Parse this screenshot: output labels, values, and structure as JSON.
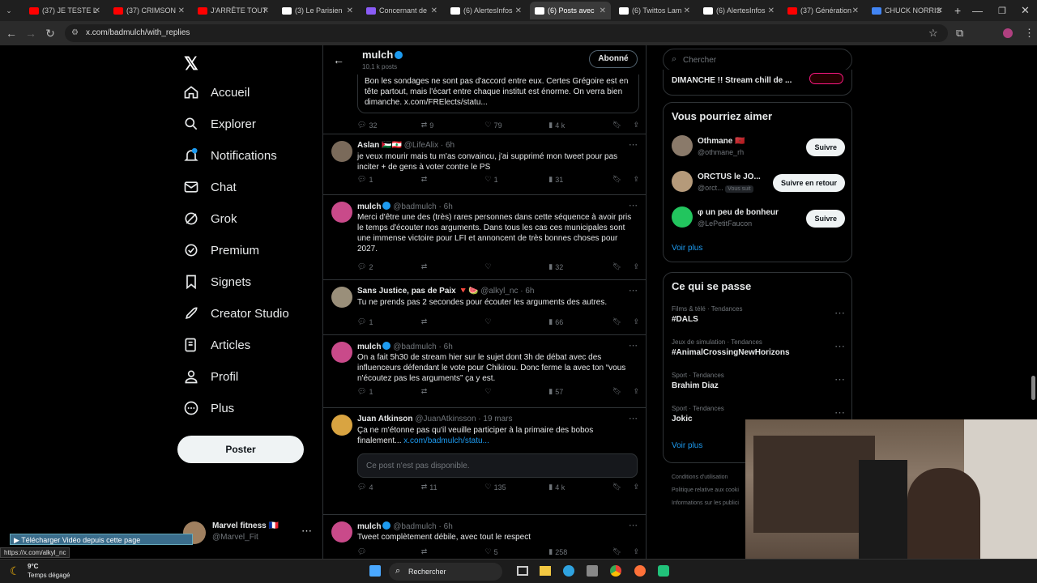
{
  "tabs": [
    {
      "label": "(37) JE TESTE L",
      "color": "#ff0000"
    },
    {
      "label": "(37) CRIMSON",
      "color": "#ff0000"
    },
    {
      "label": "J'ARRÊTE TOUT",
      "color": "#ff0000"
    },
    {
      "label": "(3) Le Parisien",
      "color": "#ffffff"
    },
    {
      "label": "Concernant de",
      "color": "#8a5cf6"
    },
    {
      "label": "(6) AlertesInfos",
      "color": "#ffffff"
    },
    {
      "label": "(6) Posts avec",
      "color": "#ffffff"
    },
    {
      "label": "(6) Twittos Lam",
      "color": "#ffffff"
    },
    {
      "label": "(6) AlertesInfos",
      "color": "#ffffff"
    },
    {
      "label": "(37) Génération",
      "color": "#ff0000"
    },
    {
      "label": "CHUCK NORRIS",
      "color": "#4285f4"
    }
  ],
  "url": "x.com/badmulch/with_replies",
  "nav": {
    "home": "Accueil",
    "explore": "Explorer",
    "notifications": "Notifications",
    "chat": "Chat",
    "grok": "Grok",
    "premium": "Premium",
    "bookmarks": "Signets",
    "creator": "Creator Studio",
    "articles": "Articles",
    "profile": "Profil",
    "more": "Plus",
    "post_button": "Poster"
  },
  "account": {
    "name": "Marvel fitness 🇫🇷",
    "handle": "@Marvel_Fit"
  },
  "header": {
    "name": "mulch",
    "posts": "10,1 k posts",
    "subscribed": "Abonné"
  },
  "tweets": [
    {
      "quote_text": "Bon les sondages ne sont pas d'accord entre eux. Certes Grégoire est en tête partout, mais l'écart entre chaque institut est énorme. On verra bien dimanche. x.com/FRElects/statu...",
      "replies": "32",
      "retweets": "9",
      "likes": "79",
      "views": "4 k"
    },
    {
      "name": "Aslan 🇵🇸🇱🇧",
      "handle": "@LifeAlix · 6h",
      "text": "je veux mourir mais tu m'as convaincu, j'ai supprimé mon tweet pour pas inciter + de gens à voter contre le PS",
      "replies": "1",
      "retweets": "",
      "likes": "1",
      "views": "31",
      "avatar": "#7a6a5a"
    },
    {
      "name": "mulch",
      "handle": "@badmulch · 6h",
      "text": "Merci d'être une des (très) rares personnes dans cette séquence à avoir pris le temps d'écouter nos arguments. Dans tous les cas ces municipales sont une immense victoire pour LFI et annoncent de très bonnes choses pour 2027.",
      "replies": "2",
      "retweets": "",
      "likes": "",
      "views": "32",
      "avatar": "#c94a8a"
    },
    {
      "name": "Sans Justice, pas de Paix 🔻🍉",
      "handle": "@alkyl_nc · 6h",
      "text": "Tu ne prends pas 2 secondes pour écouter les arguments des autres.",
      "replies": "1",
      "retweets": "",
      "likes": "",
      "views": "66",
      "avatar": "#9a8f7a"
    },
    {
      "name": "mulch",
      "handle": "@badmulch · 6h",
      "text": "On a fait 5h30 de stream hier sur le sujet dont 3h de débat avec des influenceurs défendant le vote pour Chikirou. Donc ferme la avec ton “vous n'écoutez pas les arguments” ça y est.",
      "replies": "1",
      "retweets": "",
      "likes": "",
      "views": "57",
      "avatar": "#c94a8a"
    },
    {
      "name": "Juan Atkinson",
      "handle": "@JuanAtkinsson · 19 mars",
      "text": "Ça ne m'étonne pas qu'il veuille participer à la primaire des bobos finalement...",
      "link": "x.com/badmulch/statu...",
      "unavailable": "Ce post n'est pas disponible.",
      "replies": "4",
      "retweets": "11",
      "likes": "135",
      "views": "4 k",
      "avatar": "#d9a441"
    },
    {
      "name": "mulch",
      "handle": "@badmulch · 6h",
      "text": "Tweet complètement débile, avec tout le respect",
      "replies": "",
      "retweets": "",
      "likes": "5",
      "views": "258",
      "avatar": "#c94a8a"
    }
  ],
  "search": {
    "placeholder": "Chercher"
  },
  "live_banner": "DIMANCHE !! Stream chill de ...",
  "suggestions": {
    "title": "Vous pourriez aimer",
    "items": [
      {
        "name": "Othmane 🇲🇦",
        "handle": "@othmane_rh",
        "button": "Suivre",
        "avatar": "#8a7a6a"
      },
      {
        "name": "ORCTUS le JO...",
        "handle": "@orct...",
        "badge": "Vous suit",
        "button": "Suivre en retour",
        "avatar": "#b59a7a"
      },
      {
        "name": "φ un peu de bonheur",
        "handle": "@LePetitFaucon",
        "button": "Suivre",
        "avatar": "#22c55e"
      }
    ],
    "see_more": "Voir plus"
  },
  "trends": {
    "title": "Ce qui se passe",
    "items": [
      {
        "category": "Films & télé · Tendances",
        "name": "#DALS"
      },
      {
        "category": "Jeux de simulation · Tendances",
        "name": "#AnimalCrossingNewHorizons"
      },
      {
        "category": "Sport · Tendances",
        "name": "Brahim Diaz"
      },
      {
        "category": "Sport · Tendances",
        "name": "Jokic"
      }
    ],
    "see_more": "Voir plus"
  },
  "footer_links": [
    "Conditions d'utilisation",
    "Politique relative aux cooki",
    "Informations sur les publici"
  ],
  "download_bar": "Télécharger Vidéo depuis cette page",
  "status_url": "https://x.com/alkyl_nc",
  "weather": {
    "temp": "9°C",
    "desc": "Temps dégagé"
  },
  "taskbar_search": "Rechercher"
}
